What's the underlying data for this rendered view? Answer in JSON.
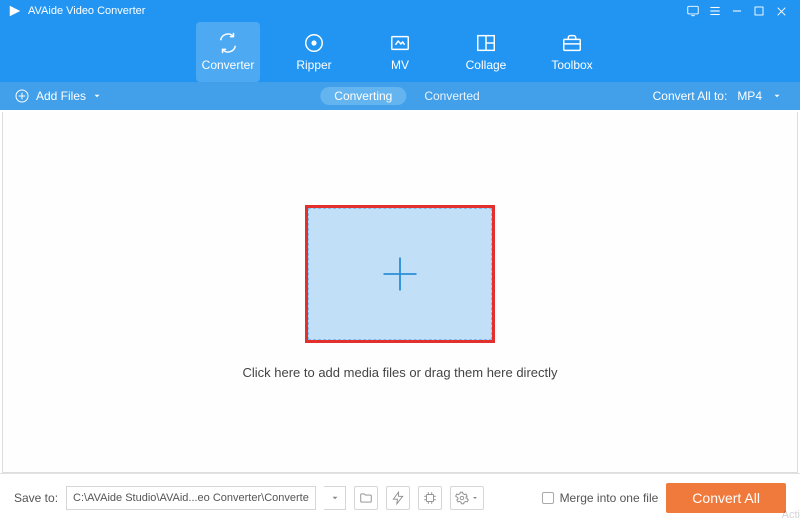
{
  "title": "AVAide Video Converter",
  "nav": [
    {
      "label": "Converter"
    },
    {
      "label": "Ripper"
    },
    {
      "label": "MV"
    },
    {
      "label": "Collage"
    },
    {
      "label": "Toolbox"
    }
  ],
  "subbar": {
    "add_files": "Add Files",
    "converting": "Converting",
    "converted": "Converted",
    "convert_all_to_label": "Convert All to:",
    "format": "MP4"
  },
  "main": {
    "hint": "Click here to add media files or drag them here directly"
  },
  "bottom": {
    "save_to_label": "Save to:",
    "save_to_path": "C:\\AVAide Studio\\AVAid...eo Converter\\Converted",
    "merge_label": "Merge into one file",
    "convert_all": "Convert All"
  },
  "watermark": "Acti"
}
